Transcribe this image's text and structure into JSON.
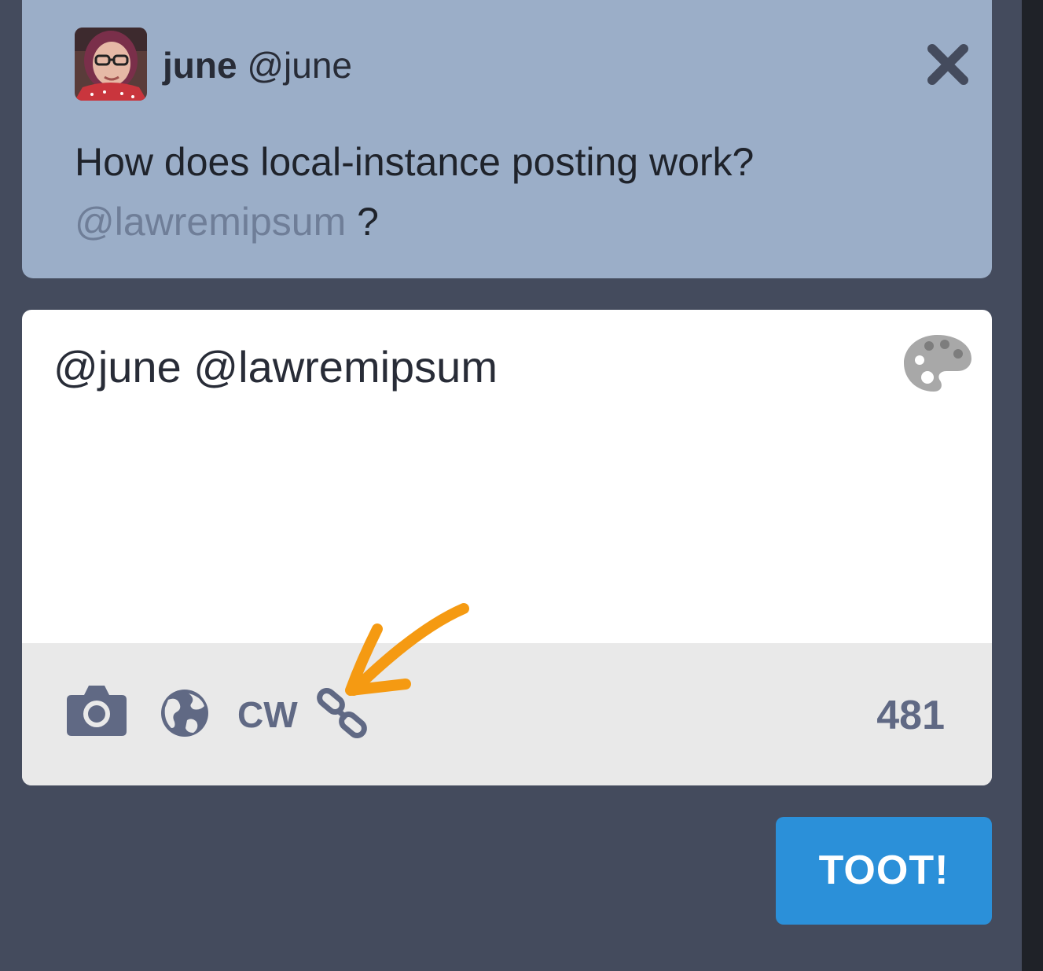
{
  "reply": {
    "display_name": "june",
    "username": "@june",
    "text": "How does local-instance posting work?",
    "mention": "@lawremipsum",
    "trailing": " ?"
  },
  "compose": {
    "text": "@june @lawremipsum",
    "cw_label": "CW",
    "char_count": "481",
    "submit_label": "TOOT!"
  },
  "colors": {
    "background": "#444b5d",
    "reply_card": "#9baec8",
    "toolbar": "#e9e9e9",
    "icon": "#606984",
    "toot_button": "#2b90d9",
    "annotation": "#f59a12"
  },
  "icons": {
    "avatar": "avatar",
    "close": "close-icon",
    "palette": "palette-icon",
    "camera": "camera-icon",
    "globe": "globe-icon",
    "link": "link-icon",
    "annotation": "annotation-arrow"
  }
}
